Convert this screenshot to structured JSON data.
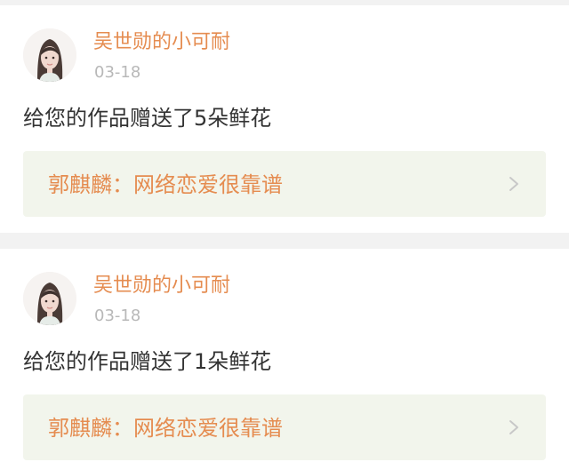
{
  "notifications": [
    {
      "avatar_icon": "user-avatar-icon",
      "username": "吴世勋的小可耐",
      "date": "03-18",
      "message": "给您的作品赠送了5朵鲜花",
      "work_link": "郭麒麟：网络恋爱很靠谱",
      "chevron_icon": "chevron-right-icon"
    },
    {
      "avatar_icon": "user-avatar-icon",
      "username": "吴世勋的小可耐",
      "date": "03-18",
      "message": "给您的作品赠送了1朵鲜花",
      "work_link": "郭麒麟：网络恋爱很靠谱",
      "chevron_icon": "chevron-right-icon"
    }
  ],
  "colors": {
    "page_background": "#f2f2f2",
    "card_background": "#ffffff",
    "accent_orange": "#e58c50",
    "date_gray": "#b8b8b8",
    "message_text": "#333333",
    "link_background": "#f2f5ec",
    "chevron_gray": "#c8c8c8"
  }
}
